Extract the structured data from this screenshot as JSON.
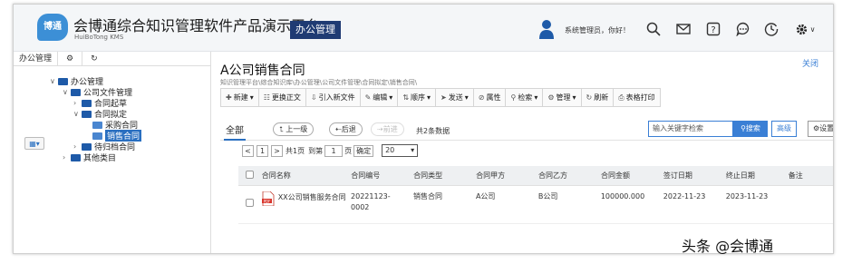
{
  "header": {
    "logo_text": "博通",
    "title": "会博通综合知识管理软件产品演示平台",
    "subtitle": "HuiBoTong KMS",
    "module": "办公管理",
    "greeting": "系统管理员，你好！"
  },
  "sidebar": {
    "tabs": [
      "办公管理"
    ],
    "tree": [
      {
        "label": "办公管理",
        "level": 0,
        "arrow": "∨"
      },
      {
        "label": "公司文件管理",
        "level": 1,
        "arrow": "∨"
      },
      {
        "label": "合同起草",
        "level": 2,
        "arrow": "›"
      },
      {
        "label": "合同拟定",
        "level": 2,
        "arrow": "∨"
      },
      {
        "label": "采购合同",
        "level": 3,
        "arrow": ""
      },
      {
        "label": "销售合同",
        "level": 3,
        "arrow": "",
        "selected": true
      },
      {
        "label": "待归档合同",
        "level": 2,
        "arrow": "›"
      },
      {
        "label": "其他类目",
        "level": 1,
        "arrow": "›"
      }
    ]
  },
  "main": {
    "title": "A公司销售合同",
    "close": "关闭",
    "breadcrumb": "知识管理平台\\综合知识库\\办公管理\\公司文件管理\\合同拟定\\销售合同\\",
    "toolbar": [
      {
        "icon": "✚",
        "label": "新建",
        "dd": true
      },
      {
        "icon": "☷",
        "label": "更换正文",
        "dd": false
      },
      {
        "icon": "⇩",
        "label": "引入新文件",
        "dd": false
      },
      {
        "icon": "✎",
        "label": "编辑",
        "dd": true
      },
      {
        "icon": "⇅",
        "label": "顺序",
        "dd": true
      },
      {
        "icon": "➤",
        "label": "发送",
        "dd": true
      },
      {
        "icon": "⊘",
        "label": "属性",
        "dd": false
      },
      {
        "icon": "⚲",
        "label": "检索",
        "dd": true
      },
      {
        "icon": "⚙",
        "label": "管理",
        "dd": true
      },
      {
        "icon": "↻",
        "label": "刷新",
        "dd": false
      },
      {
        "icon": "⎙",
        "label": "表格打印",
        "dd": false
      }
    ],
    "tab_all": "全部",
    "btn_up": "上一级",
    "btn_back": "后退",
    "btn_forward": "前进",
    "total": "共2条数据",
    "search_placeholder": "输入关键字检索",
    "search_btn": "搜索",
    "adv_btn": "高级",
    "settings_btn": "设置",
    "pager": {
      "prev": "<",
      "page": "1",
      "next": ">",
      "total_pages": "共1页",
      "goto_label": "到第",
      "goto_value": "1",
      "goto_unit": "页",
      "confirm": "确定",
      "page_size": "20"
    },
    "table": {
      "columns": [
        "合同名称",
        "合同编号",
        "合同类型",
        "合同甲方",
        "合同乙方",
        "合同金额",
        "签订日期",
        "终止日期",
        "备注"
      ],
      "rows": [
        [
          "XX公司销售服务合同",
          "20221123-0002",
          "销售合同",
          "A公司",
          "B公司",
          "100000.000",
          "2022-11-23",
          "2023-11-23",
          ""
        ]
      ]
    }
  },
  "watermark": "头条 @会博通",
  "colors": {
    "accent": "#3a7fd5",
    "module_bg": "#1f3b73",
    "folder": "#1e5aa8"
  }
}
